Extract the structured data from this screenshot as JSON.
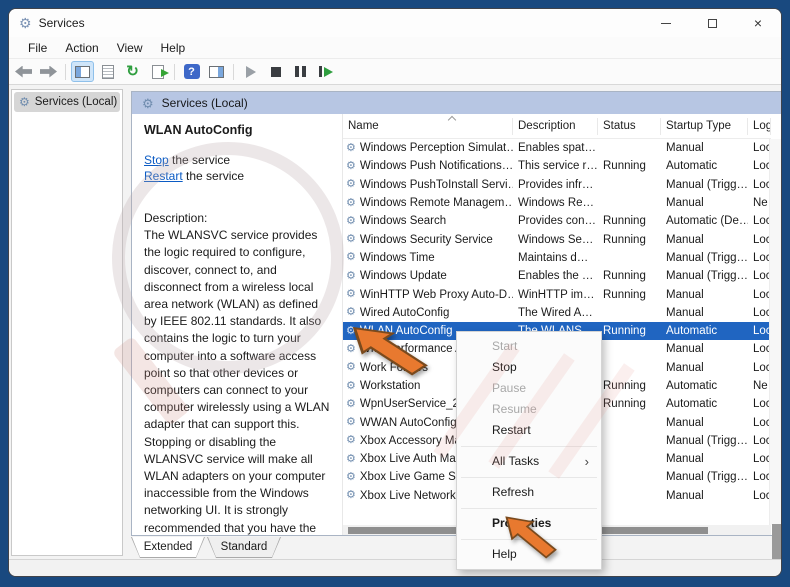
{
  "colors": {
    "desktop": "#19497f",
    "selection": "#2065c1",
    "pane_band": "#b7c6e3",
    "link": "#0b5bc4",
    "annotation_arrow": "#e8792f"
  },
  "window": {
    "title": "Services"
  },
  "menu_bar": [
    "File",
    "Action",
    "View",
    "Help"
  ],
  "toolbar": {
    "items": [
      {
        "name": "back-icon"
      },
      {
        "name": "forward-icon"
      },
      {
        "sep": true
      },
      {
        "name": "show-console-tree-icon",
        "active": true
      },
      {
        "name": "properties-window-icon"
      },
      {
        "name": "refresh-icon"
      },
      {
        "name": "export-list-icon"
      },
      {
        "sep": true
      },
      {
        "name": "help-icon"
      },
      {
        "name": "show-action-pane-icon"
      },
      {
        "sep": true
      },
      {
        "name": "start-service-icon"
      },
      {
        "name": "stop-service-icon"
      },
      {
        "name": "pause-service-icon"
      },
      {
        "name": "restart-service-icon"
      }
    ]
  },
  "tree": {
    "root_label": "Services (Local)"
  },
  "pane": {
    "header": "Services (Local)"
  },
  "detail": {
    "service_name": "WLAN AutoConfig",
    "stop_link": "Stop",
    "stop_suffix": " the service",
    "restart_link": "Restart",
    "restart_suffix": " the service",
    "description_label": "Description:",
    "description": "The WLANSVC service provides the logic required to configure, discover, connect to, and disconnect from a wireless local area network (WLAN) as defined by IEEE 802.11 standards. It also contains the logic to turn your computer into a software access point so that other devices or computers can connect to your computer wirelessly using a WLAN adapter that can support this. Stopping or disabling the WLANSVC service will make all WLAN adapters on your computer inaccessible from the Windows networking UI. It is strongly recommended that you have the WLANSVC service running if your computer has a WLAN adapter."
  },
  "list": {
    "columns": [
      "Name",
      "Description",
      "Status",
      "Startup Type",
      "Log On As"
    ],
    "sort": {
      "column": "Name",
      "direction": "ascending"
    },
    "selected_index": 10,
    "rows": [
      {
        "name": "Windows Perception Simulat…",
        "desc": "Enables spat…",
        "status": "",
        "startup": "Manual",
        "logon": "Loc"
      },
      {
        "name": "Windows Push Notifications…",
        "desc": "This service r…",
        "status": "Running",
        "startup": "Automatic",
        "logon": "Loc"
      },
      {
        "name": "Windows PushToInstall Servi…",
        "desc": "Provides infr…",
        "status": "",
        "startup": "Manual (Trigg…",
        "logon": "Loc"
      },
      {
        "name": "Windows Remote Managem…",
        "desc": "Windows Re…",
        "status": "",
        "startup": "Manual",
        "logon": "Ne"
      },
      {
        "name": "Windows Search",
        "desc": "Provides con…",
        "status": "Running",
        "startup": "Automatic (De…",
        "logon": "Loc"
      },
      {
        "name": "Windows Security Service",
        "desc": "Windows Se…",
        "status": "Running",
        "startup": "Manual",
        "logon": "Loc"
      },
      {
        "name": "Windows Time",
        "desc": "Maintains d…",
        "status": "",
        "startup": "Manual (Trigg…",
        "logon": "Loc"
      },
      {
        "name": "Windows Update",
        "desc": "Enables the …",
        "status": "Running",
        "startup": "Manual (Trigg…",
        "logon": "Loc"
      },
      {
        "name": "WinHTTP Web Proxy Auto-D…",
        "desc": "WinHTTP im…",
        "status": "Running",
        "startup": "Manual",
        "logon": "Loc"
      },
      {
        "name": "Wired AutoConfig",
        "desc": "The Wired A…",
        "status": "",
        "startup": "Manual",
        "logon": "Loc"
      },
      {
        "name": "WLAN AutoConfig",
        "desc": "The WLANS…",
        "status": "Running",
        "startup": "Automatic",
        "logon": "Loc"
      },
      {
        "name": "WMI Performance Adapter",
        "desc": "",
        "status": "",
        "startup": "Manual",
        "logon": "Loc"
      },
      {
        "name": "Work Folders",
        "desc": "",
        "status": "",
        "startup": "Manual",
        "logon": "Loc"
      },
      {
        "name": "Workstation",
        "desc": "",
        "status": "Running",
        "startup": "Automatic",
        "logon": "Ne"
      },
      {
        "name": "WpnUserService_28…",
        "desc": "",
        "status": "Running",
        "startup": "Automatic",
        "logon": "Loc"
      },
      {
        "name": "WWAN AutoConfig",
        "desc": "",
        "status": "",
        "startup": "Manual",
        "logon": "Loc"
      },
      {
        "name": "Xbox Accessory Manage…",
        "desc": "",
        "status": "",
        "startup": "Manual (Trigg…",
        "logon": "Loc"
      },
      {
        "name": "Xbox Live Auth Manager",
        "desc": "",
        "status": "",
        "startup": "Manual",
        "logon": "Loc"
      },
      {
        "name": "Xbox Live Game Save",
        "desc": "",
        "status": "",
        "startup": "Manual (Trigg…",
        "logon": "Loc"
      },
      {
        "name": "Xbox Live Networking Ser…",
        "desc": "",
        "status": "",
        "startup": "Manual",
        "logon": "Loc"
      }
    ]
  },
  "context_menu": {
    "items": [
      {
        "label": "Start",
        "disabled": true
      },
      {
        "label": "Stop"
      },
      {
        "label": "Pause",
        "disabled": true
      },
      {
        "label": "Resume",
        "disabled": true
      },
      {
        "label": "Restart"
      },
      {
        "sep": true
      },
      {
        "label": "All Tasks",
        "submenu": true
      },
      {
        "sep": true
      },
      {
        "label": "Refresh"
      },
      {
        "sep": true
      },
      {
        "label": "Properties",
        "bold": true
      },
      {
        "sep": true
      },
      {
        "label": "Help"
      }
    ]
  },
  "tabs": [
    {
      "label": "Extended",
      "active": true
    },
    {
      "label": "Standard",
      "active": false
    }
  ]
}
